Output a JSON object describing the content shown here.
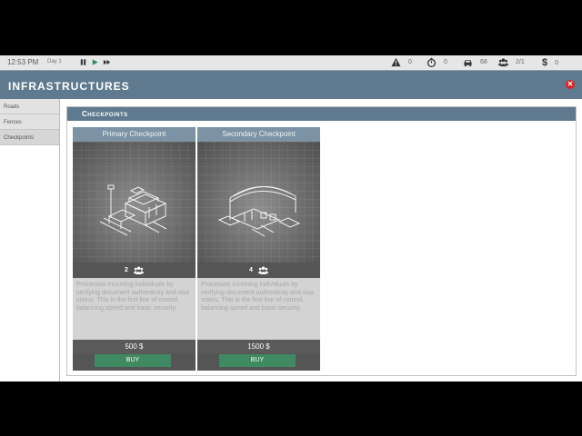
{
  "topbar": {
    "time": "12:53 PM",
    "day": "Day 1",
    "controls": {
      "pause_icon": "pause-icon",
      "play_icon": "play-icon",
      "fast_forward_icon": "fast-forward-icon"
    },
    "stats": [
      {
        "icon": "warning-icon",
        "value": "0"
      },
      {
        "icon": "stopwatch-icon",
        "value": "0"
      },
      {
        "icon": "car-icon",
        "value": "68"
      },
      {
        "icon": "group-icon",
        "value": "2/1"
      },
      {
        "icon": "dollar-icon",
        "value": "0"
      }
    ]
  },
  "header": {
    "title": "INFRASTRUCTURES",
    "close_icon": "close-icon"
  },
  "sidebar": {
    "items": [
      {
        "label": "Roads"
      },
      {
        "label": "Fences"
      },
      {
        "label": "Checkpoints",
        "active": true
      }
    ]
  },
  "panel": {
    "title": "Checkpoints",
    "cards": [
      {
        "title": "Primary Checkpoint",
        "staff": "2",
        "description": "Processes incoming individuals by verifying document authenticity and visa status. This is the first line of control, balancing speed and basic security.",
        "price": "500 $",
        "buy_label": "BUY"
      },
      {
        "title": "Secondary Checkpoint",
        "staff": "4",
        "description": "Processes incoming individuals by verifying document authenticity and visa status. This is the first line of control, balancing speed and basic security.",
        "price": "1500 $",
        "buy_label": "BUY"
      }
    ]
  },
  "colors": {
    "header": "#5f7a8e",
    "card_title": "#7b93a4",
    "buy": "#3f8a62",
    "close": "#d9231f"
  }
}
